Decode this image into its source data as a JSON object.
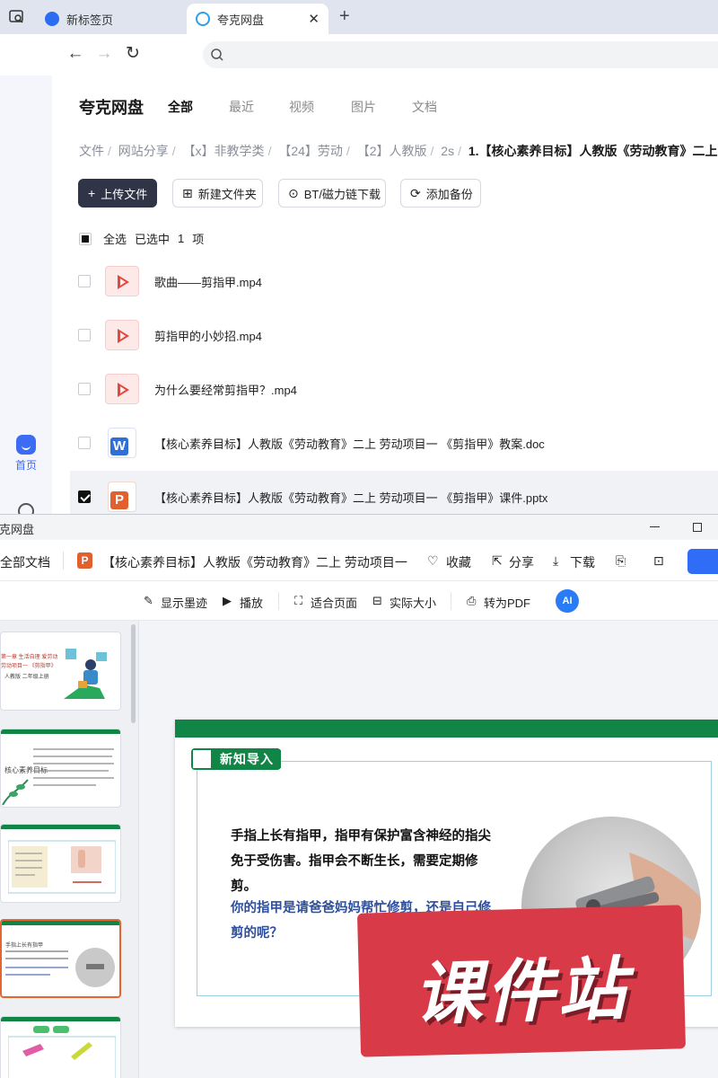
{
  "browser": {
    "tabs": [
      {
        "label": "新标签页",
        "active": false
      },
      {
        "label": "夸克网盘",
        "active": true
      }
    ],
    "new_tab_label": "+",
    "close_label": "✕"
  },
  "app": {
    "title": "夸克网盘",
    "nav_tabs": [
      "全部",
      "最近",
      "视频",
      "图片",
      "文档"
    ],
    "active_tab": "全部"
  },
  "breadcrumb": [
    "文件",
    "网站分享",
    "【x】非教学类",
    "【24】劳动",
    "【2】人教版",
    "2s",
    "1.【核心素养目标】人教版《劳动教育》二上"
  ],
  "toolbar": {
    "upload": "上传文件",
    "new_folder": "新建文件夹",
    "bt_download": "BT/磁力链下载",
    "add_backup": "添加备份"
  },
  "selection": {
    "select_all": "全选",
    "selected_prefix": "已选中",
    "selected_count": "1",
    "unit": "项"
  },
  "files": [
    {
      "name": "歌曲——剪指甲.mp4",
      "type": "video",
      "checked": false
    },
    {
      "name": "剪指甲的小妙招.mp4",
      "type": "video",
      "checked": false
    },
    {
      "name": "为什么要经常剪指甲？.mp4",
      "type": "video",
      "checked": false
    },
    {
      "name": "【核心素养目标】人教版《劳动教育》二上 劳动项目一 《剪指甲》教案.doc",
      "type": "doc",
      "checked": false
    },
    {
      "name": "【核心素养目标】人教版《劳动教育》二上 劳动项目一 《剪指甲》课件.pptx",
      "type": "ppt",
      "checked": true
    }
  ],
  "rail": {
    "home_label": "首页"
  },
  "viewer": {
    "window_title": "夸克网盘",
    "all_docs": "全部文档",
    "doc_title": "【核心素养目标】人教版《劳动教育》二上 劳动项目一",
    "favorite": "收藏",
    "share": "分享",
    "download": "下载",
    "toolbar2": {
      "show_ink": "显示墨迹",
      "play": "播放",
      "fit_page": "适合页面",
      "actual_size": "实际大小",
      "to_pdf": "转为PDF",
      "ai": "AI"
    },
    "thumbs": {
      "t1_line1": "第一章 生活自理 爱劳动",
      "t1_line2": "劳动项目一 《剪指甲》",
      "t1_line3": "人教版   二年级上册",
      "t2_text": "核心素养目标",
      "t4_text": "手指上长有指甲"
    },
    "slide": {
      "section_label": "新知导入",
      "paragraph": "手指上长有指甲，指甲有保护富含神经的指尖免于受伤害。指甲会不断生长，需要定期修剪。",
      "question": "你的指甲是请爸爸妈妈帮忙修剪，还是自己修剪的呢？"
    },
    "watermark": "课件站"
  }
}
